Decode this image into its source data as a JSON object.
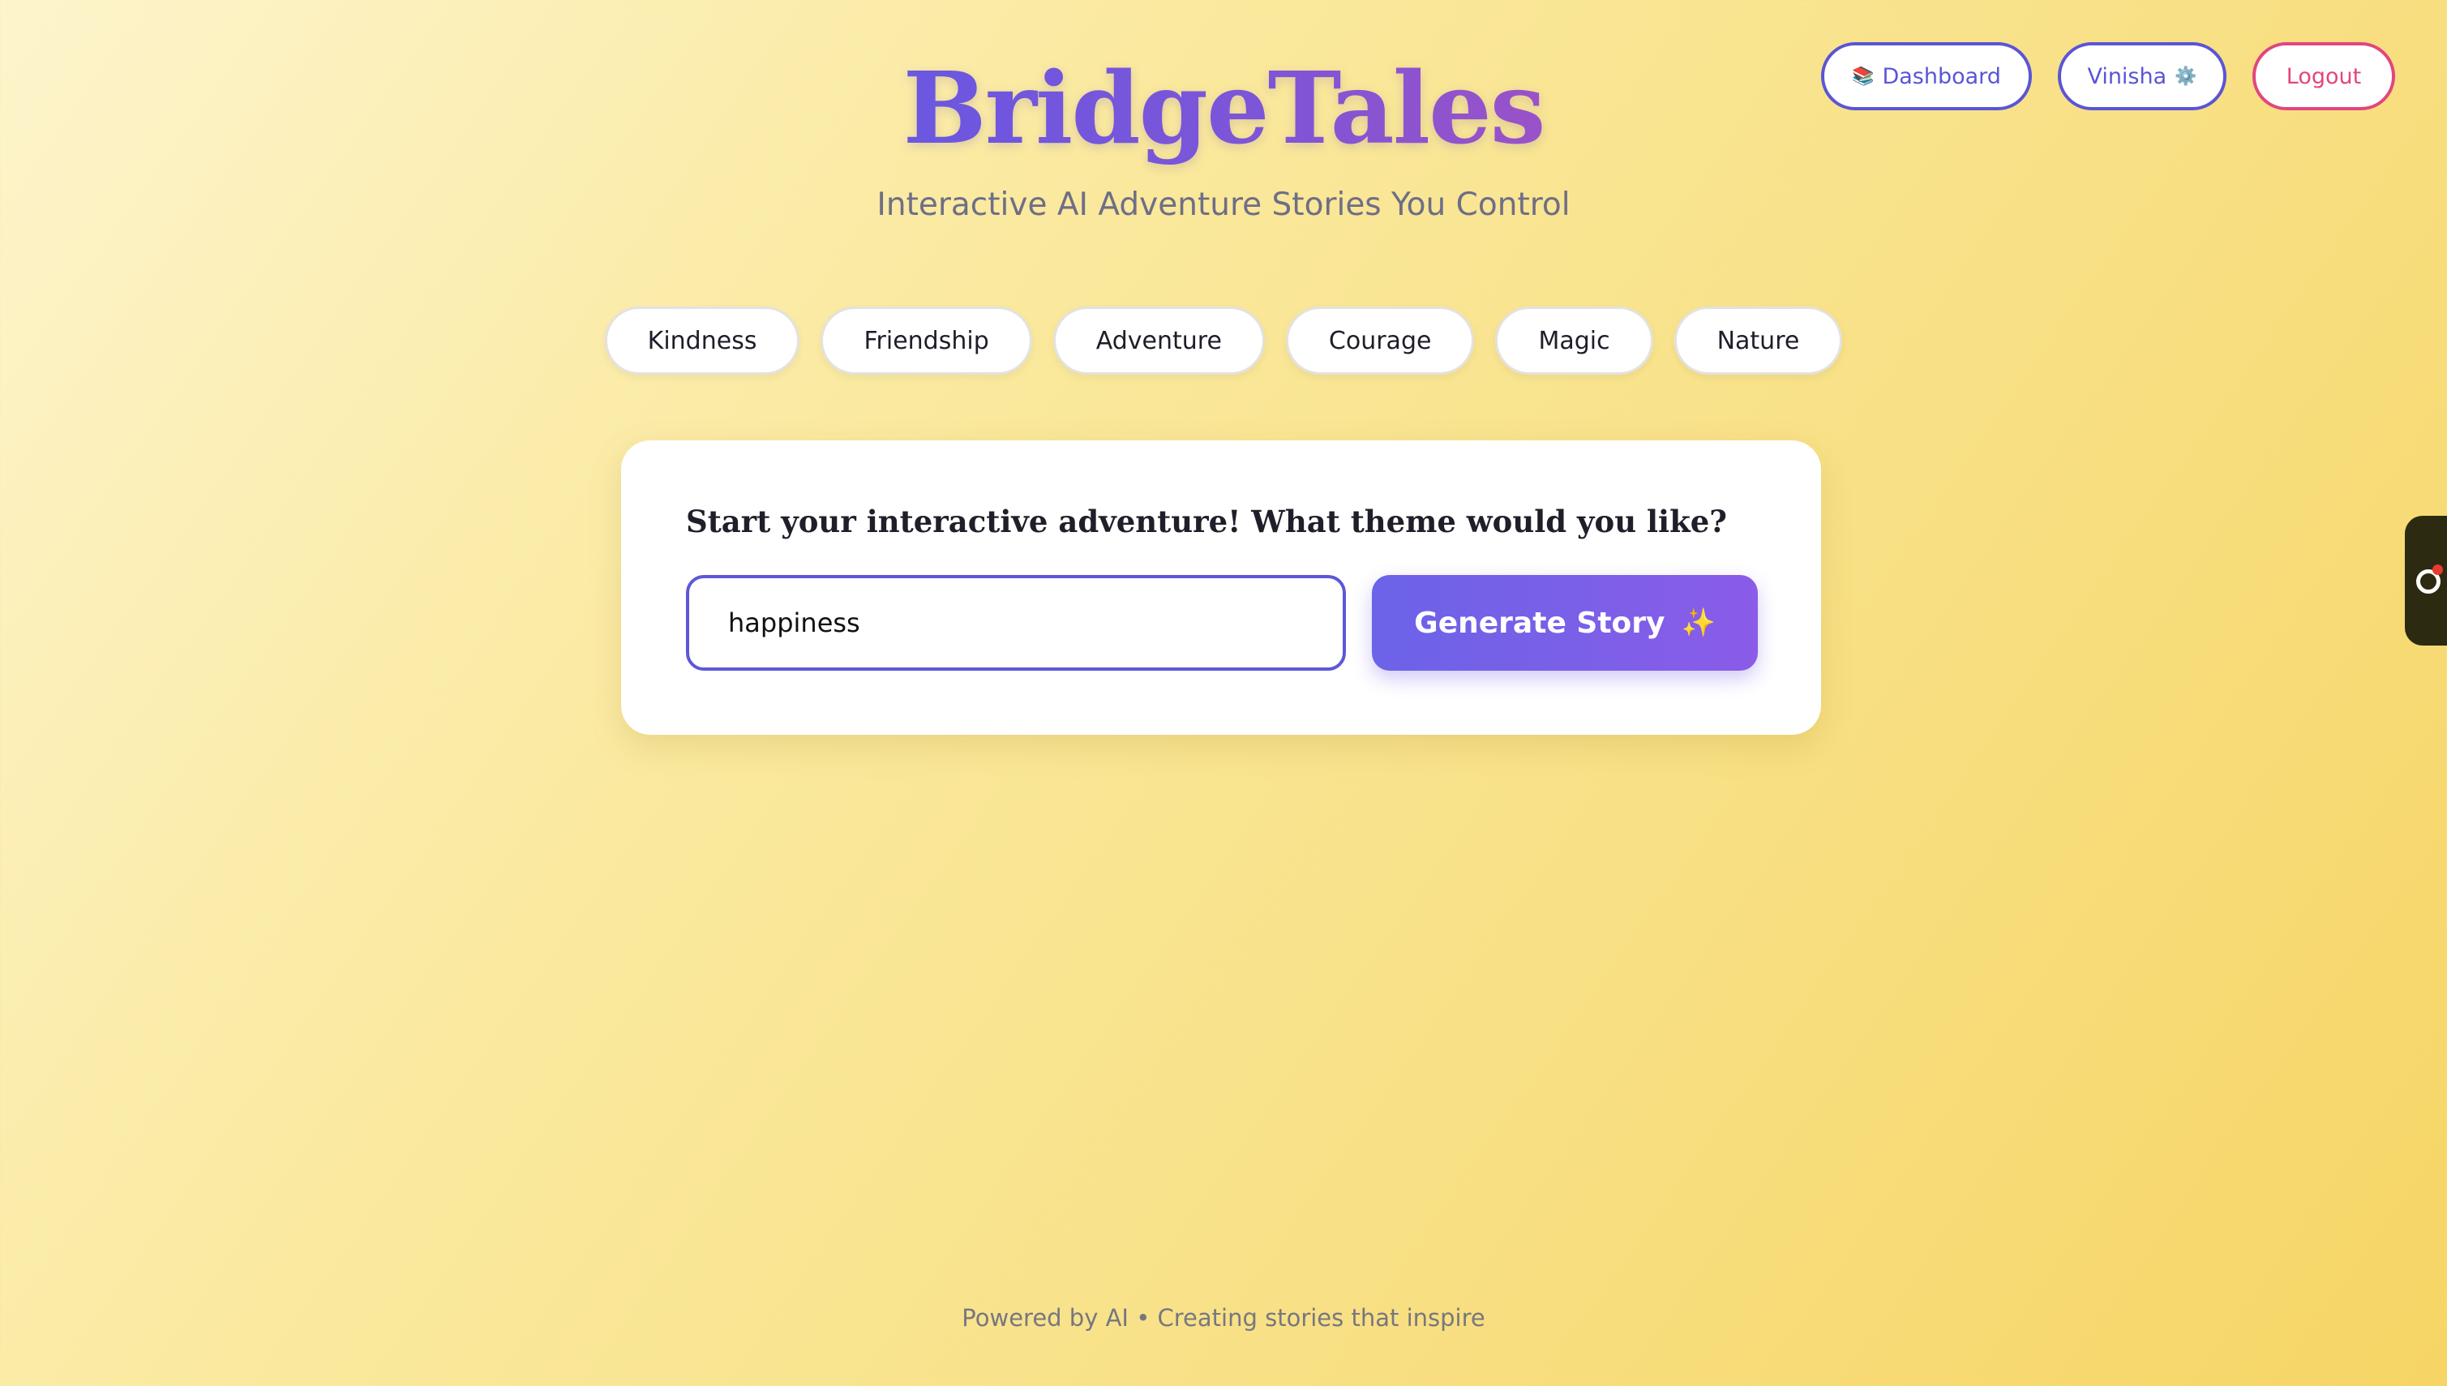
{
  "header": {
    "title": "BridgeTales",
    "subtitle": "Interactive AI Adventure Stories You Control",
    "dashboard_icon": "📚",
    "dashboard_label": "Dashboard",
    "user_label": "Vinisha",
    "user_icon": "⚙️",
    "logout_label": "Logout"
  },
  "themes": [
    "Kindness",
    "Friendship",
    "Adventure",
    "Courage",
    "Magic",
    "Nature"
  ],
  "story_form": {
    "prompt": "Start your interactive adventure! What theme would you like?",
    "input_value": "happiness",
    "generate_label": "Generate Story",
    "generate_icon": "✨"
  },
  "footer": {
    "text": "Powered by AI • Creating stories that inspire"
  },
  "colors": {
    "accent": "#5a55d6",
    "logout": "#e2467f",
    "button_gradient_start": "#6b63e8",
    "button_gradient_end": "#8a5ce8",
    "background": "#f8e085"
  }
}
